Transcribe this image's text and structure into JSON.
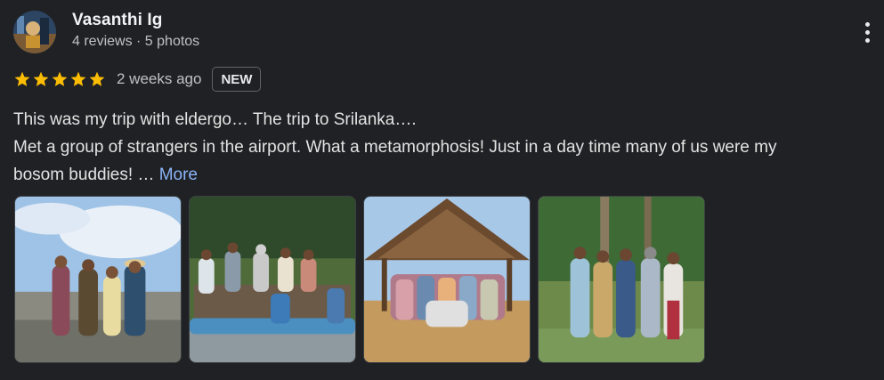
{
  "reviewer": {
    "name": "Vasanthi Ig",
    "meta": "4 reviews · 5 photos"
  },
  "rating": {
    "stars": 5,
    "time": "2 weeks ago",
    "badge": "NEW",
    "star_color": "#fbbc04"
  },
  "review": {
    "line1": "This was my trip with eldergo… The trip to Srilanka….",
    "line2": "Met a group of strangers in the airport. What a metamorphosis! Just in a day time many of us were my",
    "line3": "bosom buddies! … ",
    "more_label": "More"
  },
  "photos": [
    {
      "name": "beach-group-photo"
    },
    {
      "name": "boat-group-photo"
    },
    {
      "name": "hut-group-photo"
    },
    {
      "name": "garden-group-photo"
    }
  ],
  "colors": {
    "background": "#202124",
    "link": "#8ab4f8"
  }
}
